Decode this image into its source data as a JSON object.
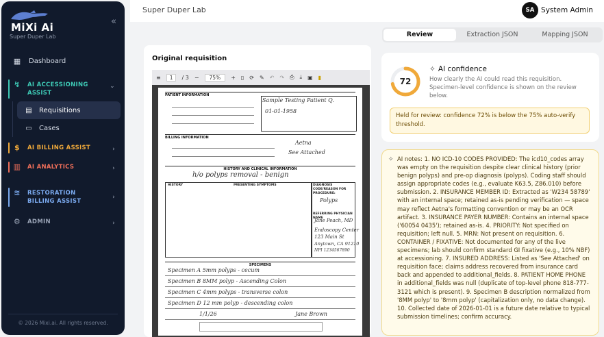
{
  "sidebar": {
    "logo_text": "MiXi Ai",
    "logo_subtitle": "Super Duper Lab",
    "collapse_icon": "«",
    "dashboard": "Dashboard",
    "groups": [
      {
        "label": "AI ACCESSIONING ASSIST",
        "color": "#3ec9b5",
        "expanded": true
      },
      {
        "label": "AI BILLING ASSIST",
        "color": "#f0a93a"
      },
      {
        "label": "AI ANALYTICS",
        "color": "#ef6f5a"
      },
      {
        "label": "RESTORATION BILLING ASSIST",
        "color": "#7aa9ee"
      },
      {
        "label": "ADMIN",
        "color": "#9aa4b6"
      }
    ],
    "sub_items": [
      {
        "label": "Requisitions",
        "active": true
      },
      {
        "label": "Cases"
      }
    ],
    "footer": "© 2026 Mixi.ai. All rights reserved."
  },
  "topbar": {
    "brand": "Super Duper Lab",
    "avatar_initials": "SA",
    "username": "System Admin"
  },
  "requisition": {
    "title": "Original requisition",
    "toolbar": {
      "page_current": "1",
      "page_total": "/ 3",
      "zoom": "75%"
    },
    "form": {
      "patient_section": "PATIENT INFORMATION",
      "billing_section": "BILLING INFORMATION",
      "history_section": "HISTORY AND CLINICAL INFORMATION",
      "history_label": "HISTORY",
      "symptoms_label": "PRESENTING SYMPTOMS",
      "diagnosis_label": "DIAGNOSIS CODE/REASON FOR PROCEDURE:",
      "physician_label": "REFERRING PHYSICIAN NAME",
      "specimens_section": "SPECIMENS",
      "hw_name": "Sample Testing  Patient Q.",
      "hw_dob": "01-01-1958",
      "hw_member": "Aetna",
      "hw_see_attached": "See Attached",
      "hw_history": "h/o polyps removal - benign",
      "hw_diag": "Polyps",
      "hw_physician": "Jane Peach, MD",
      "hw_facility": "Endoscopy Center",
      "hw_addr1": "123 Main St",
      "hw_addr2": "Anytown, CA 91210",
      "hw_npi": "NPI 1234567890",
      "hw_spec_a": "Specimen A  5mm polyps - cecum",
      "hw_spec_b": "Specimen B  8MM polyp - Ascending Colon",
      "hw_spec_c": "Specimen C  4mm polyps - transverse colon",
      "hw_spec_d": "Specimen D  12 mm polyp - descending colon",
      "hw_date": "1/1/26",
      "hw_collected": "Jane Brown"
    }
  },
  "tabs": [
    {
      "label": "Review",
      "active": true
    },
    {
      "label": "Extraction JSON"
    },
    {
      "label": "Mapping JSON"
    }
  ],
  "confidence": {
    "value": "72",
    "fraction": 0.72,
    "title": "AI confidence",
    "description": "How clearly the AI could read this requisition. Specimen-level confidence is shown on the review below.",
    "held_message": "Held for review: confidence 72% is below the 75% auto-verify threshold.",
    "ring_color": "#f0a93a"
  },
  "notes": {
    "text": "AI notes: 1. NO ICD-10 CODES PROVIDED: The icd10_codes array was empty on the requisition despite clear clinical history (prior benign polyps) and pre-op diagnosis (polyps). Coding staff should assign appropriate codes (e.g., evaluate K63.5, Z86.010) before submission. 2. INSURANCE MEMBER ID: Extracted as 'W234 58789' with an internal space; retained as-is pending verification — space may reflect Aetna's formatting convention or may be an OCR artifact. 3. INSURANCE PAYER NUMBER: Contains an internal space ('60054 0435'); retained as-is. 4. PRIORITY: Not specified on requisition; left null. 5. MRN: Not present on requisition. 6. CONTAINER / FIXATIVE: Not documented for any of the live specimens; lab should confirm standard GI fixative (e.g., 10% NBF) at accessioning. 7. INSURED ADDRESS: Listed as 'See Attached' on requisition face; claims address recovered from insurance card back and appended to additional_fields. 8. PATIENT HOME PHONE in additional_fields was null (duplicate of top-level phone 818-777-3121 which is present). 9. Specimen B description normalized from '8MM polyp' to '8mm polyp' (capitalization only, no data change). 10. Collected date of 2026-01-01 is a future date relative to typical submission timelines; confirm accuracy."
  }
}
